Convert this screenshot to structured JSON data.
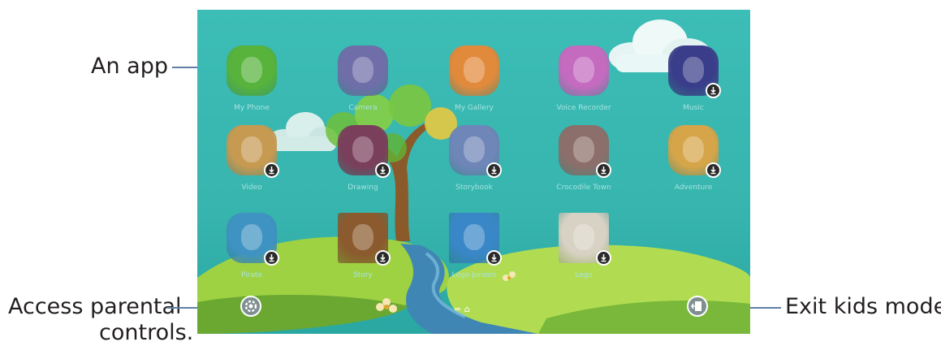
{
  "callouts": {
    "an_app": "An app",
    "parental_line1": "Access parental",
    "parental_line2": "controls.",
    "exit": "Exit kids mode."
  },
  "colors": {
    "sky": "#3cbdb6",
    "hill_light": "#a8d84a",
    "hill_dark": "#5a9a2e",
    "river": "#3f86b5",
    "callout_line": "#5f7fa8",
    "badge": "#2a2a2a"
  },
  "apps": [
    {
      "label": "My Phone",
      "icon": "crocodile-phone-icon",
      "color": "#57b33b",
      "download": false
    },
    {
      "label": "Camera",
      "icon": "sloth-camera-icon",
      "color": "#6f6ea8",
      "download": false
    },
    {
      "label": "My Gallery",
      "icon": "sloth-gallery-icon",
      "color": "#e28a3c",
      "download": false
    },
    {
      "label": "Voice Recorder",
      "icon": "pink-walrus-icon",
      "color": "#c46bbf",
      "download": false
    },
    {
      "label": "Music",
      "icon": "music-guitar-icon",
      "color": "#3a3e8a",
      "download": true
    },
    {
      "label": "Video",
      "icon": "owl-3d-glasses-icon",
      "color": "#c79a52",
      "download": true
    },
    {
      "label": "Drawing",
      "icon": "walrus-paint-icon",
      "color": "#7a3f5a",
      "download": true
    },
    {
      "label": "Storybook",
      "icon": "bird-book-icon",
      "color": "#6f86b8",
      "download": true
    },
    {
      "label": "Crocodile Town",
      "icon": "crocodile-house-icon",
      "color": "#8c6f6a",
      "download": true
    },
    {
      "label": "Adventure",
      "icon": "crocodile-snail-icon",
      "color": "#d6a54a",
      "download": true
    },
    {
      "label": "Pirate",
      "icon": "crocodile-pirate-icon",
      "color": "#3f93c3",
      "download": true
    },
    {
      "label": "Story",
      "icon": "girl-portrait-icon",
      "color": "#8b5a2e",
      "download": true
    },
    {
      "label": "Lego Juniors",
      "icon": "lego-bricks-icon",
      "color": "#3a87c8",
      "download": true
    },
    {
      "label": "Lego",
      "icon": "lego-blocks-icon",
      "color": "#d8d2c4",
      "download": true
    }
  ],
  "bottom_bar": {
    "settings_icon": "gear-icon",
    "exit_icon": "exit-door-icon",
    "home_text": "= ⌂"
  }
}
